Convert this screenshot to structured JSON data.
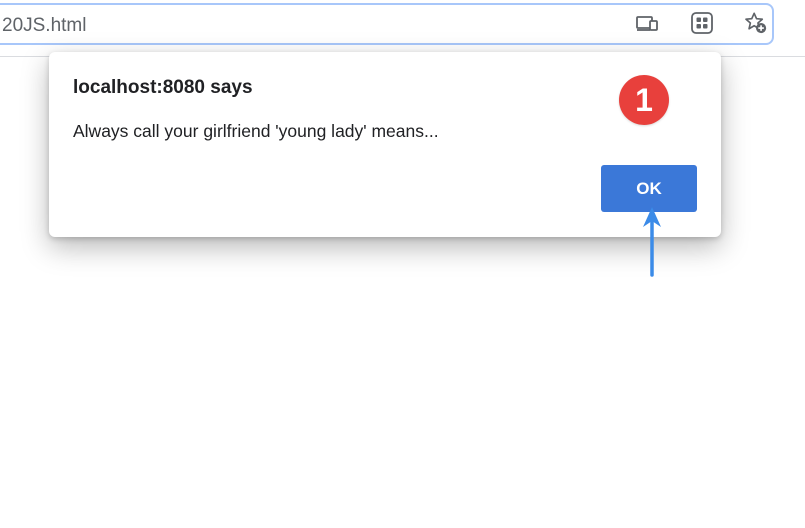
{
  "browser": {
    "url_text": "20JS.html",
    "icons": [
      "cast-device-icon",
      "extensions-grid-icon",
      "bookmark-star-add-icon"
    ]
  },
  "dialog": {
    "title": "localhost:8080 says",
    "message": "Always call your girlfriend 'young lady' means...",
    "ok_label": "OK"
  },
  "annotation": {
    "step_number": "1",
    "badge_color": "#e8403c",
    "arrow_color": "#3b8be8"
  },
  "colors": {
    "ok_button": "#3b78d8",
    "address_border": "#a8c7fa"
  }
}
